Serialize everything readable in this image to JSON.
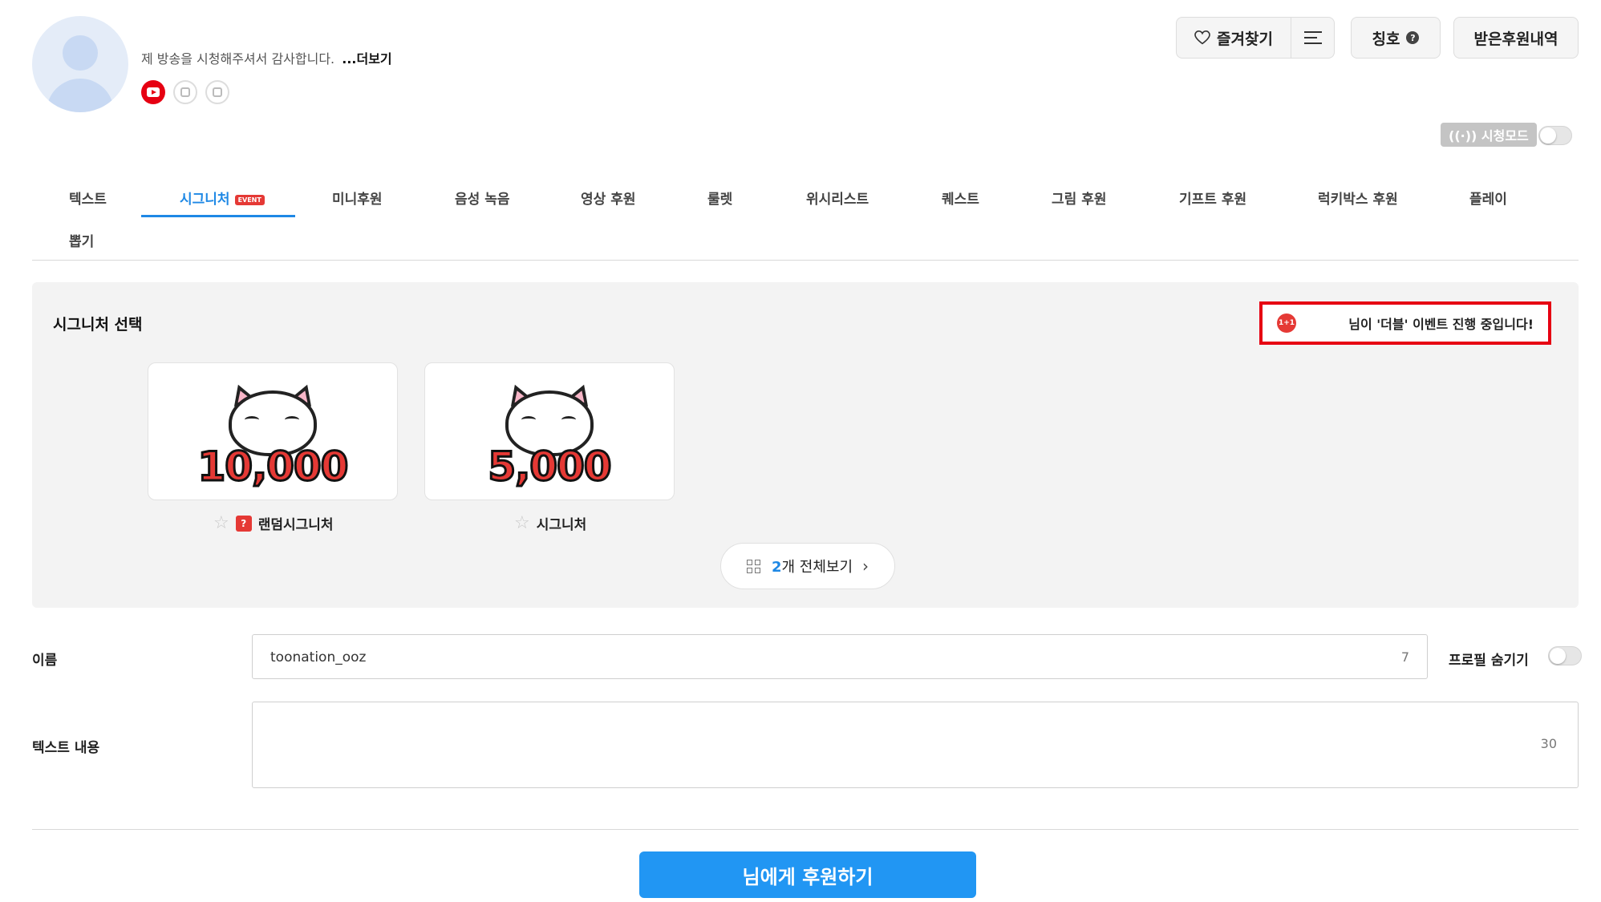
{
  "header": {
    "greeting": "제 방송을 시청해주셔서 감사합니다.",
    "more_label": "...더보기",
    "social": [
      "youtube-icon",
      "profile-icon",
      "twitch-icon"
    ],
    "favorite_label": "즐겨찾기",
    "title_label": "칭호",
    "history_label": "받은후원내역",
    "watch_mode_label": "((·)) 시청모드",
    "watch_mode_on": false
  },
  "tabs": {
    "items": [
      {
        "label": "텍스트",
        "active": false
      },
      {
        "label": "시그니처",
        "active": true,
        "badge": "EVENT"
      },
      {
        "label": "미니후원",
        "active": false
      },
      {
        "label": "음성 녹음",
        "active": false
      },
      {
        "label": "영상 후원",
        "active": false
      },
      {
        "label": "룰렛",
        "active": false
      },
      {
        "label": "위시리스트",
        "active": false
      },
      {
        "label": "퀘스트",
        "active": false
      },
      {
        "label": "그림 후원",
        "active": false
      },
      {
        "label": "기프트 후원",
        "active": false
      },
      {
        "label": "럭키박스 후원",
        "active": false
      },
      {
        "label": "플레이",
        "active": false
      },
      {
        "label": "뽑기",
        "active": false
      }
    ]
  },
  "signature": {
    "title": "시그니처 선택",
    "event_icon_text": "1+1",
    "event_text": "님이 '더블' 이벤트 진행 중입니다!",
    "cards": [
      {
        "price": "10,000",
        "label": "랜덤시그니처",
        "badge": "?"
      },
      {
        "price": "5,000",
        "label": "시그니처"
      }
    ],
    "view_all_count": "2",
    "view_all_label": "개 전체보기"
  },
  "form": {
    "name_label": "이름",
    "name_value": "toonation_ooz",
    "name_remaining": "7",
    "hide_profile_label": "프로필 숨기기",
    "hide_profile_on": false,
    "text_label": "텍스트 내용",
    "text_value": "",
    "text_remaining": "30"
  },
  "donate_label": "님에게 후원하기",
  "colors": {
    "accent": "#1e88e5",
    "button": "#2196f3",
    "event_border": "#e60012",
    "price_red": "#e53935"
  }
}
